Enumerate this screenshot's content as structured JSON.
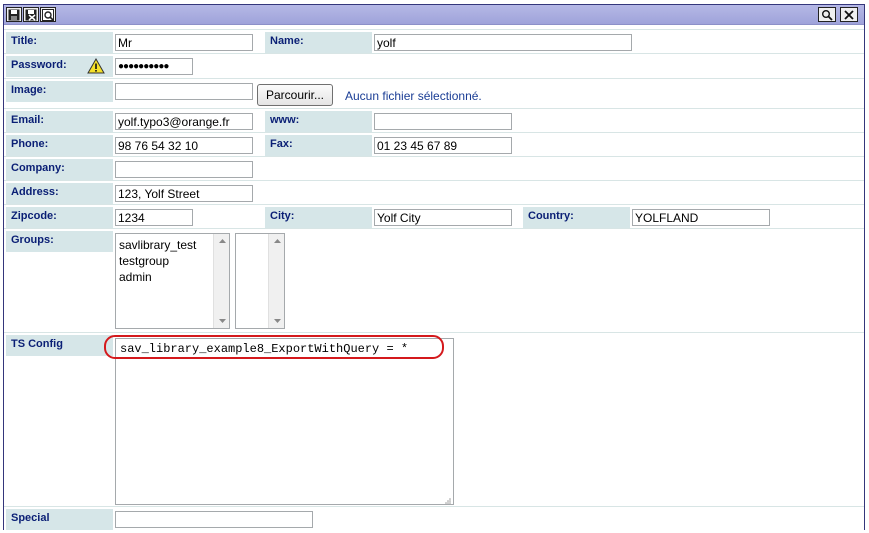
{
  "toolbar": {
    "left_icons": [
      "save-icon",
      "save-close-icon",
      "preview-icon"
    ],
    "right_icons": [
      "search-icon",
      "close-icon"
    ]
  },
  "form": {
    "title": {
      "label": "Title:",
      "value": "Mr"
    },
    "name": {
      "label": "Name:",
      "value": "yolf"
    },
    "password": {
      "label": "Password:",
      "value": "●●●●●●●●●●"
    },
    "image": {
      "label": "Image:",
      "value": "",
      "browse_label": "Parcourir...",
      "no_file": "Aucun fichier sélectionné."
    },
    "email": {
      "label": "Email:",
      "value": "yolf.typo3@orange.fr"
    },
    "www": {
      "label": "www:",
      "value": ""
    },
    "phone": {
      "label": "Phone:",
      "value": "98 76 54 32 10"
    },
    "fax": {
      "label": "Fax:",
      "value": "01 23 45 67 89"
    },
    "company": {
      "label": "Company:",
      "value": ""
    },
    "address": {
      "label": "Address:",
      "value": "123, Yolf Street"
    },
    "zipcode": {
      "label": "Zipcode:",
      "value": "1234"
    },
    "city": {
      "label": "City:",
      "value": "Yolf City"
    },
    "country": {
      "label": "Country:",
      "value": "YOLFLAND"
    },
    "groups": {
      "label": "Groups:",
      "options": [
        "savlibrary_test",
        "testgroup",
        "admin"
      ],
      "selected": []
    },
    "tsconfig": {
      "label": "TS Config",
      "value": "sav_library_example8_ExportWithQuery = *"
    },
    "special": {
      "label": "Special",
      "value": ""
    }
  },
  "colors": {
    "label_bg": "#d6e6e8",
    "label_text": "#0a1f75",
    "titlebar": "#a9acdf",
    "highlight_ring": "#d4191c"
  }
}
